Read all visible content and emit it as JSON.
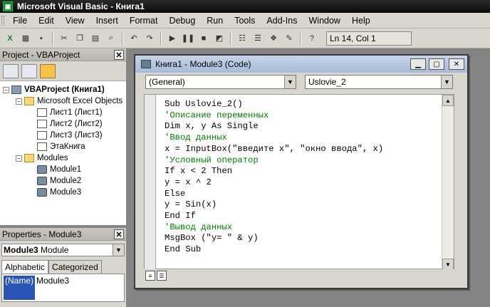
{
  "window": {
    "title": "Microsoft Visual Basic - Книга1"
  },
  "menu": [
    "File",
    "Edit",
    "View",
    "Insert",
    "Format",
    "Debug",
    "Run",
    "Tools",
    "Add-Ins",
    "Window",
    "Help"
  ],
  "toolbar": {
    "position": "Ln 14, Col 1",
    "icons": [
      "excel-icon",
      "insert-module-icon",
      "save-icon",
      "cut-icon",
      "copy-icon",
      "paste-icon",
      "find-icon",
      "undo-icon",
      "redo-icon",
      "run-icon",
      "break-icon",
      "reset-icon",
      "design-mode-icon",
      "project-explorer-icon",
      "properties-icon",
      "object-browser-icon",
      "toolbox-icon",
      "help-icon"
    ]
  },
  "project": {
    "title": "Project - VBAProject",
    "close": "✕",
    "tree": [
      {
        "label": "VBAProject (Книга1)",
        "level": 0,
        "type": "proj",
        "expander": "−"
      },
      {
        "label": "Microsoft Excel Objects",
        "level": 1,
        "type": "fold",
        "expander": "−"
      },
      {
        "label": "Лист1 (Лист1)",
        "level": 2,
        "type": "sheet",
        "expander": ""
      },
      {
        "label": "Лист2 (Лист2)",
        "level": 2,
        "type": "sheet",
        "expander": ""
      },
      {
        "label": "Лист3 (Лист3)",
        "level": 2,
        "type": "sheet",
        "expander": ""
      },
      {
        "label": "ЭтаКнига",
        "level": 2,
        "type": "sheet",
        "expander": ""
      },
      {
        "label": "Modules",
        "level": 1,
        "type": "fold",
        "expander": "−"
      },
      {
        "label": "Module1",
        "level": 2,
        "type": "mod",
        "expander": ""
      },
      {
        "label": "Module2",
        "level": 2,
        "type": "mod",
        "expander": ""
      },
      {
        "label": "Module3",
        "level": 2,
        "type": "mod",
        "expander": ""
      }
    ]
  },
  "properties": {
    "title": "Properties - Module3",
    "close": "✕",
    "object_bold": "Module3",
    "object_type": "Module",
    "tabs": [
      "Alphabetic",
      "Categorized"
    ],
    "row": {
      "name": "(Name)",
      "value": "Module3"
    }
  },
  "code_window": {
    "title": "Книга1 - Module3 (Code)",
    "object_combo": "(General)",
    "proc_combo": "Uslovie_2",
    "lines": [
      {
        "text": "Sub Uslovie_2()",
        "style": "tx"
      },
      {
        "text": "'Описание переменных",
        "style": "cm"
      },
      {
        "text": "Dim x, y As Single",
        "style": "tx"
      },
      {
        "text": "'Ввод данных",
        "style": "cm"
      },
      {
        "text": "x = InputBox(\"введите x\", \"окно ввода\", x)",
        "style": "tx"
      },
      {
        "text": "'Условный оператор",
        "style": "cm"
      },
      {
        "text": "If x < 2 Then",
        "style": "tx"
      },
      {
        "text": "y = x ^ 2",
        "style": "tx"
      },
      {
        "text": "Else",
        "style": "tx"
      },
      {
        "text": "y = Sin(x)",
        "style": "tx"
      },
      {
        "text": "End If",
        "style": "tx"
      },
      {
        "text": "'Вывод данных",
        "style": "cm"
      },
      {
        "text": "MsgBox (\"y= \" & y)",
        "style": "tx"
      },
      {
        "text": "End Sub",
        "style": "tx"
      }
    ]
  },
  "colors": {
    "comment": "#008000",
    "keyword": "#000080",
    "selection": "#2a55b8"
  }
}
